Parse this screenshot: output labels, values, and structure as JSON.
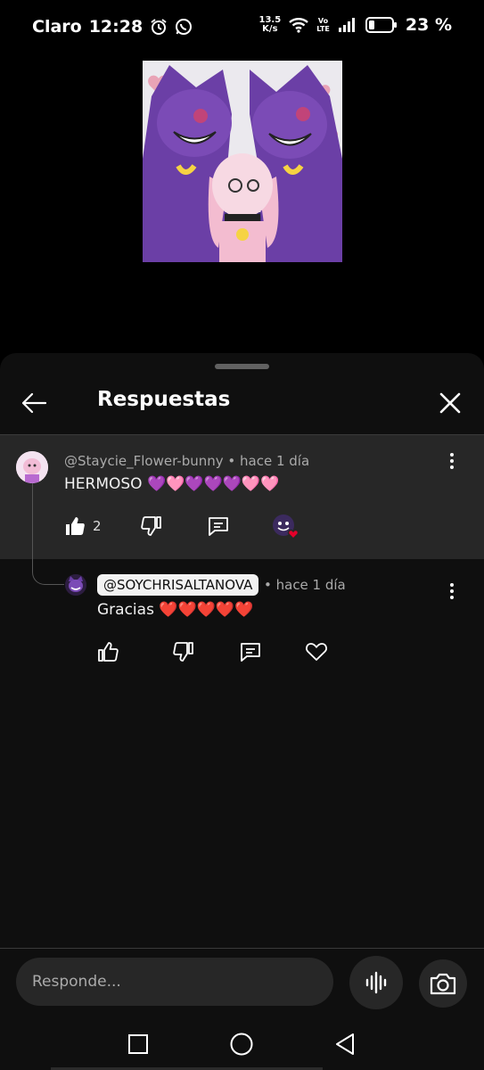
{
  "status_bar": {
    "carrier": "Claro",
    "time": "12:28",
    "net_speed_value": "13.5",
    "net_speed_unit": "K/s",
    "volte_top": "Vo",
    "volte_bottom": "LTE",
    "battery_percent": "23 %"
  },
  "sheet": {
    "title": "Respuestas"
  },
  "parent_comment": {
    "meta": "@Staycie_Flower-bunny • hace 1 día",
    "text": "HERMOSO 💜🩷💜💜💜🩷🩷",
    "like_count": "2"
  },
  "reply_comment": {
    "mention": "@SOYCHRISALTANOVA",
    "meta": "• hace 1 día",
    "text": "Gracias ❤️❤️❤️❤️❤️"
  },
  "composer": {
    "placeholder": "Responde..."
  },
  "colors": {
    "background": "#000000",
    "sheet": "#0f0f0f",
    "highlight": "#272727",
    "secondary_text": "#aaaaaa",
    "heart_red": "#e5002a",
    "purple": "#7a3fa8"
  }
}
